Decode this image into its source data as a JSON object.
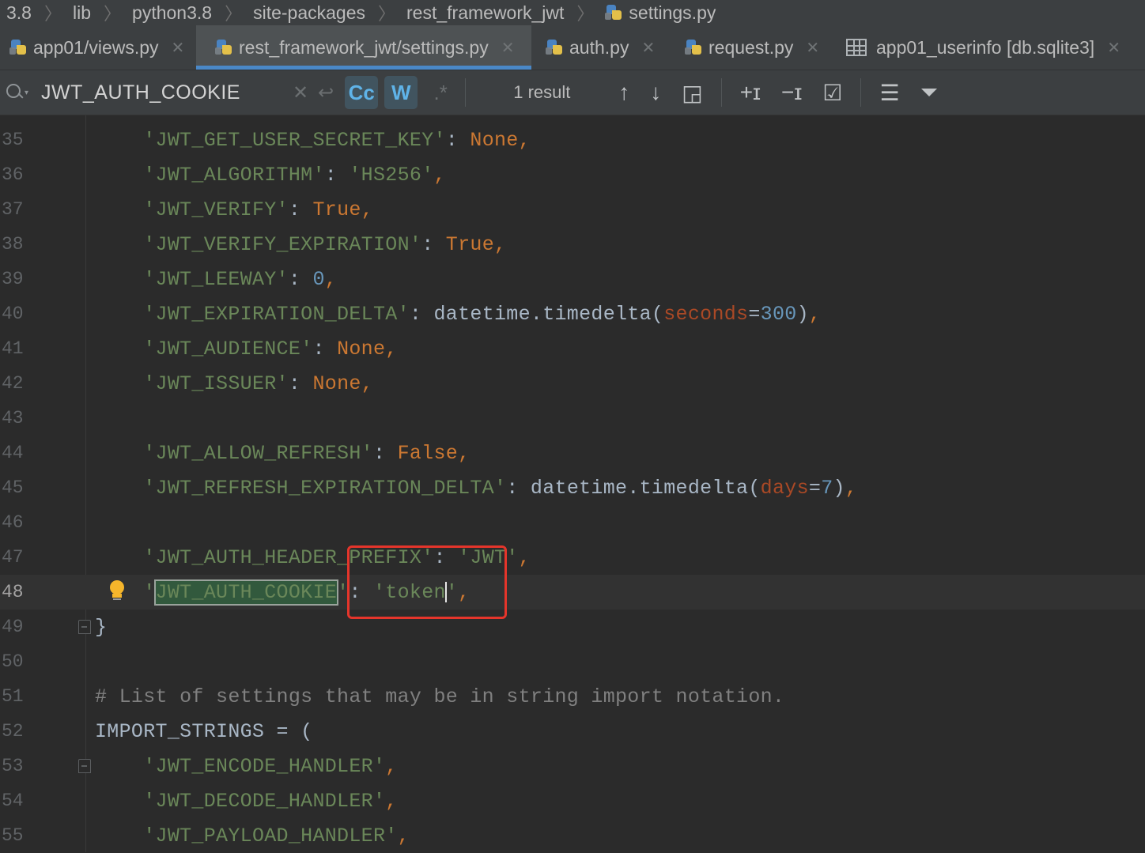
{
  "breadcrumb": [
    "3.8",
    "lib",
    "python3.8",
    "site-packages",
    "rest_framework_jwt",
    "settings.py"
  ],
  "tabs": [
    {
      "label": "app01/views.py",
      "icon": "python-file-icon",
      "active": false
    },
    {
      "label": "rest_framework_jwt/settings.py",
      "icon": "python-file-icon",
      "active": true
    },
    {
      "label": "auth.py",
      "icon": "python-file-icon",
      "active": false
    },
    {
      "label": "request.py",
      "icon": "python-file-icon",
      "active": false
    },
    {
      "label": "app01_userinfo [db.sqlite3]",
      "icon": "table-icon",
      "active": false
    }
  ],
  "search": {
    "query": "JWT_AUTH_COOKIE",
    "match_case_label": "Cc",
    "words_label": "W",
    "regex_label": ".*",
    "results": "1 result"
  },
  "colors": {
    "string": "#6a8759",
    "keyword": "#cc7832",
    "number": "#6897bb",
    "param": "#aa4926",
    "comment": "#808080",
    "tab_underline": "#4a88c7",
    "annotation_box": "#e5352b"
  },
  "editor": {
    "current_line": "48",
    "lines": [
      {
        "n": "35"
      },
      {
        "n": "36"
      },
      {
        "n": "37"
      },
      {
        "n": "38"
      },
      {
        "n": "39"
      },
      {
        "n": "40"
      },
      {
        "n": "41"
      },
      {
        "n": "42"
      },
      {
        "n": "43"
      },
      {
        "n": "44"
      },
      {
        "n": "45"
      },
      {
        "n": "46"
      },
      {
        "n": "47"
      },
      {
        "n": "48"
      },
      {
        "n": "49"
      },
      {
        "n": "50"
      },
      {
        "n": "51"
      },
      {
        "n": "52"
      },
      {
        "n": "53"
      },
      {
        "n": "54"
      },
      {
        "n": "55"
      }
    ],
    "code": {
      "l35_key": "'JWT_GET_USER_SECRET_KEY'",
      "l35_val": "None",
      "l36_key": "'JWT_ALGORITHM'",
      "l36_val": "'HS256'",
      "l37_key": "'JWT_VERIFY'",
      "l37_val": "True",
      "l38_key": "'JWT_VERIFY_EXPIRATION'",
      "l38_val": "True",
      "l39_key": "'JWT_LEEWAY'",
      "l39_val": "0",
      "l40_key": "'JWT_EXPIRATION_DELTA'",
      "l40_call": "datetime.timedelta(",
      "l40_param": "seconds",
      "l40_num": "300",
      "l41_key": "'JWT_AUDIENCE'",
      "l41_val": "None",
      "l42_key": "'JWT_ISSUER'",
      "l42_val": "None",
      "l44_key": "'JWT_ALLOW_REFRESH'",
      "l44_val": "False",
      "l45_key": "'JWT_REFRESH_EXPIRATION_DELTA'",
      "l45_call": "datetime.timedelta(",
      "l45_param": "days",
      "l45_num": "7",
      "l47_key": "'JWT_AUTH_HEADER_PREFIX'",
      "l47_val": "'JWT'",
      "l48_q": "'",
      "l48_match": "JWT_AUTH_COOKIE",
      "l48_q2": "'",
      "l48_val_a": "'token",
      "l48_val_b": "'",
      "l49": "}",
      "l51": "# List of settings that may be in string import notation.",
      "l52": "IMPORT_STRINGS = (",
      "l53": "'JWT_ENCODE_HANDLER'",
      "l54": "'JWT_DECODE_HANDLER'",
      "l55": "'JWT_PAYLOAD_HANDLER'"
    }
  }
}
